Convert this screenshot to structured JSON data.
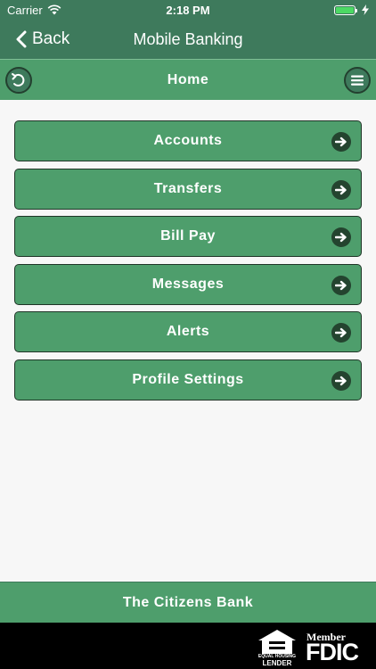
{
  "status_bar": {
    "carrier": "Carrier",
    "time": "2:18 PM",
    "battery_level": 1.0,
    "wifi_icon": "wifi-icon",
    "charging_icon": "bolt-icon"
  },
  "nav": {
    "back_label": "Back",
    "title": "Mobile Banking"
  },
  "sub_header": {
    "title": "Home",
    "left_icon": "undo-icon",
    "right_icon": "menu-icon"
  },
  "menu": {
    "items": [
      {
        "label": "Accounts"
      },
      {
        "label": "Transfers"
      },
      {
        "label": "Bill Pay"
      },
      {
        "label": "Messages"
      },
      {
        "label": "Alerts"
      },
      {
        "label": "Profile Settings"
      }
    ]
  },
  "footer": {
    "bank_name": "The Citizens Bank",
    "ehl_line1": "EQUAL HOUSING",
    "ehl_line2": "LENDER",
    "fdic_member": "Member",
    "fdic_name": "FDIC"
  },
  "colors": {
    "header": "#3e7a5c",
    "button": "#4e9e6c",
    "button_border": "#1f3527",
    "background": "#f7f7f7"
  }
}
